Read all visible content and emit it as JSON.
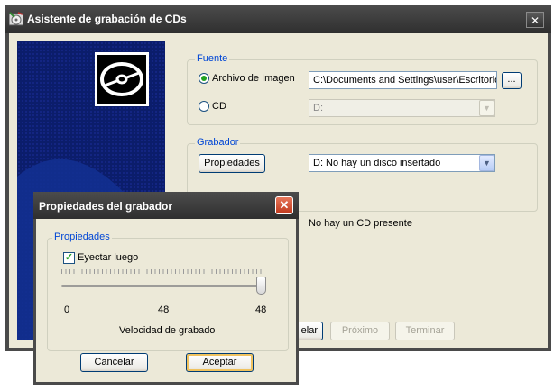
{
  "main_window": {
    "title": "Asistente de grabación de CDs",
    "close_symbol": "✕",
    "fuente": {
      "label": "Fuente",
      "image_option": "Archivo de Imagen",
      "image_path": "C:\\Documents and Settings\\user\\Escritorio",
      "browse_label": "...",
      "cd_option": "CD",
      "cd_drive": "D:"
    },
    "grabador": {
      "label": "Grabador",
      "properties_button": "Propiedades",
      "drive_selected": "D: No hay un disco insertado"
    },
    "status_text": "No hay un CD presente",
    "buttons": {
      "cancel_partial": "elar",
      "next": "Próximo",
      "finish": "Terminar"
    }
  },
  "dialog": {
    "title": "Propiedades del grabador",
    "close_symbol": "✕",
    "group_label": "Propiedades",
    "eject_label": "Eyectar luego",
    "eject_checked": true,
    "check_mark": "✓",
    "slider": {
      "min_label": "0",
      "mid_label": "48",
      "max_label": "48",
      "value_fraction": 1.0,
      "caption": "Velocidad de grabado"
    },
    "cancel_button": "Cancelar",
    "accept_button": "Aceptar"
  },
  "icons": {
    "app": "cd-burner-icon",
    "banner": "disc-icon"
  },
  "colors": {
    "group_label": "#0046d5",
    "banner": "#0b1d6b",
    "titlebar": "#3a3a3a"
  }
}
